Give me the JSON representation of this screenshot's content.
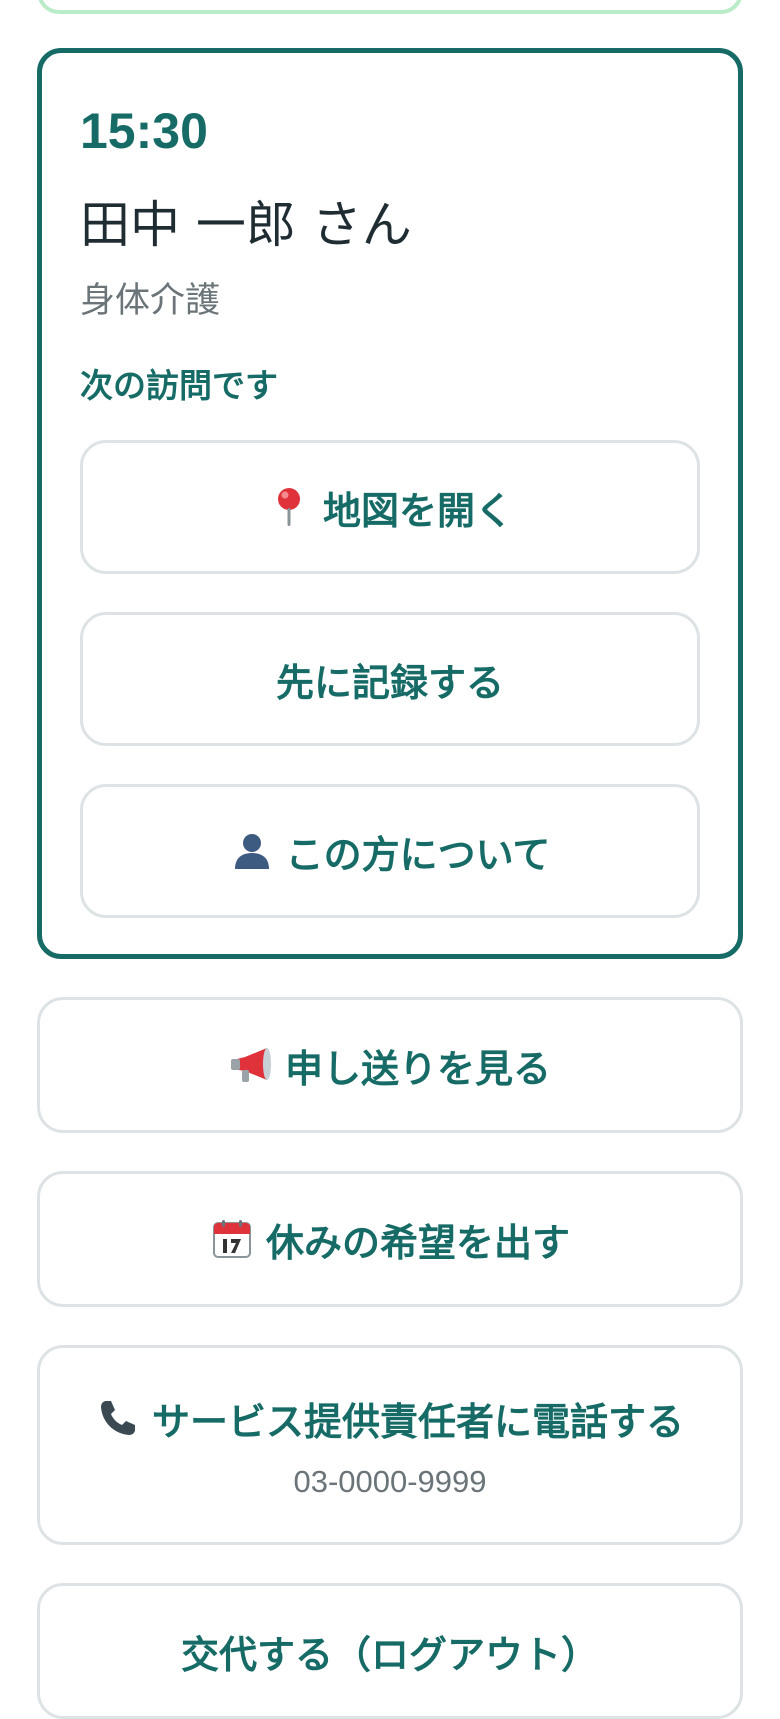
{
  "visit": {
    "time": "15:30",
    "client_name": "田中 一郎 さん",
    "service_type": "身体介護",
    "status_label": "次の訪問です",
    "actions": {
      "open_map": "地図を開く",
      "record_first": "先に記録する",
      "about_client": "この方について"
    }
  },
  "menu": {
    "handover": "申し送りを見る",
    "day_off_request": "休みの希望を出す",
    "call_manager": "サービス提供責任者に電話する",
    "manager_phone": "03-0000-9999",
    "logout": "交代する（ログアウト）"
  },
  "icons": {
    "map": "map-pin-icon",
    "person": "person-icon",
    "handover": "megaphone-icon",
    "calendar": "calendar-icon",
    "phone": "phone-icon"
  },
  "colors": {
    "accent": "#176b66",
    "border": "#dde3e5",
    "previous_card_border": "#b9ecc7",
    "muted_text": "#6b7478"
  }
}
